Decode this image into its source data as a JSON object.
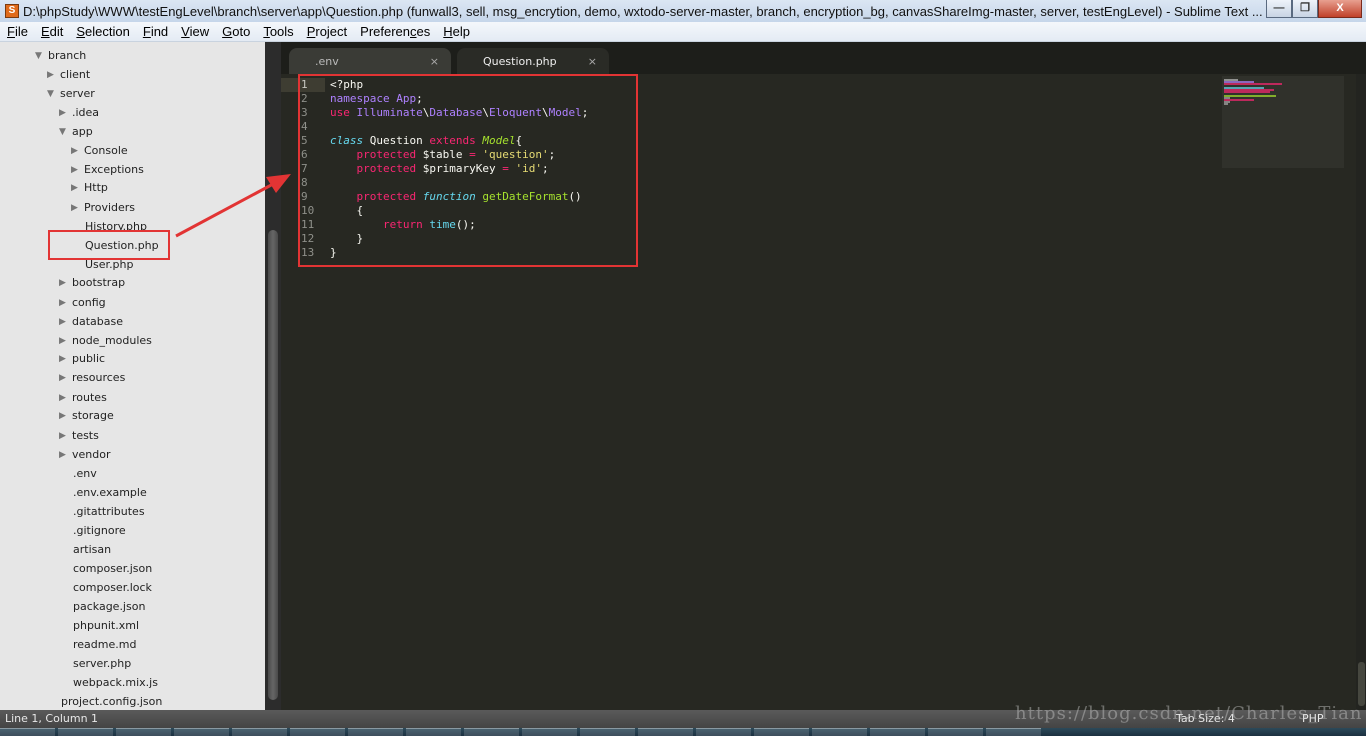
{
  "window": {
    "app_icon_label": "S",
    "title": "D:\\phpStudy\\WWW\\testEngLevel\\branch\\server\\app\\Question.php (funwall3, sell, msg_encrytion, demo, wxtodo-server-master, branch, encryption_bg, canvasShareImg-master, server, testEngLevel) - Sublime Text ...",
    "minimize_glyph": "—",
    "maximize_glyph": "❐",
    "close_glyph": "X"
  },
  "menu": [
    {
      "label": "File"
    },
    {
      "label": "Edit"
    },
    {
      "label": "Selection"
    },
    {
      "label": "Find"
    },
    {
      "label": "View"
    },
    {
      "label": "Goto"
    },
    {
      "label": "Tools"
    },
    {
      "label": "Project"
    },
    {
      "label": "Preferences"
    },
    {
      "label": "Help"
    }
  ],
  "sidebar": {
    "items": [
      {
        "label": "branch",
        "type": "folder-open"
      },
      {
        "label": "client",
        "type": "folder-closed"
      },
      {
        "label": "server",
        "type": "folder-open"
      },
      {
        "label": ".idea",
        "type": "folder-closed"
      },
      {
        "label": "app",
        "type": "folder-open"
      },
      {
        "label": "Console",
        "type": "folder-closed"
      },
      {
        "label": "Exceptions",
        "type": "folder-closed"
      },
      {
        "label": "Http",
        "type": "folder-closed"
      },
      {
        "label": "Providers",
        "type": "folder-closed"
      },
      {
        "label": "History.php",
        "type": "file"
      },
      {
        "label": "Question.php",
        "type": "file",
        "highlighted": true
      },
      {
        "label": "User.php",
        "type": "file"
      },
      {
        "label": "bootstrap",
        "type": "folder-closed"
      },
      {
        "label": "config",
        "type": "folder-closed"
      },
      {
        "label": "database",
        "type": "folder-closed"
      },
      {
        "label": "node_modules",
        "type": "folder-closed"
      },
      {
        "label": "public",
        "type": "folder-closed"
      },
      {
        "label": "resources",
        "type": "folder-closed"
      },
      {
        "label": "routes",
        "type": "folder-closed"
      },
      {
        "label": "storage",
        "type": "folder-closed"
      },
      {
        "label": "tests",
        "type": "folder-closed"
      },
      {
        "label": "vendor",
        "type": "folder-closed"
      },
      {
        "label": ".env",
        "type": "file"
      },
      {
        "label": ".env.example",
        "type": "file"
      },
      {
        "label": ".gitattributes",
        "type": "file"
      },
      {
        "label": ".gitignore",
        "type": "file"
      },
      {
        "label": "artisan",
        "type": "file"
      },
      {
        "label": "composer.json",
        "type": "file"
      },
      {
        "label": "composer.lock",
        "type": "file"
      },
      {
        "label": "package.json",
        "type": "file"
      },
      {
        "label": "phpunit.xml",
        "type": "file"
      },
      {
        "label": "readme.md",
        "type": "file"
      },
      {
        "label": "server.php",
        "type": "file"
      },
      {
        "label": "webpack.mix.js",
        "type": "file"
      },
      {
        "label": "project.config.json",
        "type": "file"
      }
    ]
  },
  "tabs": [
    {
      "label": ".env",
      "active": false,
      "close_glyph": "×"
    },
    {
      "label": "Question.php",
      "active": true,
      "close_glyph": "×"
    }
  ],
  "editor": {
    "current_line": 1,
    "line_numbers": [
      "1",
      "2",
      "3",
      "4",
      "5",
      "6",
      "7",
      "8",
      "9",
      "10",
      "11",
      "12",
      "13"
    ],
    "lines": [
      [
        {
          "t": "<?php",
          "c": "plain"
        }
      ],
      [
        {
          "t": "namespace",
          "c": "ns"
        },
        {
          "t": " ",
          "c": "plain"
        },
        {
          "t": "App",
          "c": "ns"
        },
        {
          "t": ";",
          "c": "plain"
        }
      ],
      [
        {
          "t": "use",
          "c": "kw"
        },
        {
          "t": " ",
          "c": "plain"
        },
        {
          "t": "Illuminate",
          "c": "ns"
        },
        {
          "t": "\\",
          "c": "plain"
        },
        {
          "t": "Database",
          "c": "ns"
        },
        {
          "t": "\\",
          "c": "plain"
        },
        {
          "t": "Eloquent",
          "c": "ns"
        },
        {
          "t": "\\",
          "c": "plain"
        },
        {
          "t": "Model",
          "c": "ns"
        },
        {
          "t": ";",
          "c": "plain"
        }
      ],
      [],
      [
        {
          "t": "class",
          "c": "st"
        },
        {
          "t": " Question ",
          "c": "plain"
        },
        {
          "t": "extends",
          "c": "kw"
        },
        {
          "t": " ",
          "c": "plain"
        },
        {
          "t": "Model",
          "c": "cls-ext"
        },
        {
          "t": "{",
          "c": "plain"
        }
      ],
      [
        {
          "t": "    ",
          "c": "plain"
        },
        {
          "t": "protected",
          "c": "kw"
        },
        {
          "t": " $table ",
          "c": "plain"
        },
        {
          "t": "=",
          "c": "kw"
        },
        {
          "t": " ",
          "c": "plain"
        },
        {
          "t": "'question'",
          "c": "str"
        },
        {
          "t": ";",
          "c": "plain"
        }
      ],
      [
        {
          "t": "    ",
          "c": "plain"
        },
        {
          "t": "protected",
          "c": "kw"
        },
        {
          "t": " $primaryKey ",
          "c": "plain"
        },
        {
          "t": "=",
          "c": "kw"
        },
        {
          "t": " ",
          "c": "plain"
        },
        {
          "t": "'id'",
          "c": "str"
        },
        {
          "t": ";",
          "c": "plain"
        }
      ],
      [],
      [
        {
          "t": "    ",
          "c": "plain"
        },
        {
          "t": "protected",
          "c": "kw"
        },
        {
          "t": " ",
          "c": "plain"
        },
        {
          "t": "function",
          "c": "st"
        },
        {
          "t": " ",
          "c": "plain"
        },
        {
          "t": "getDateFormat",
          "c": "fn"
        },
        {
          "t": "()",
          "c": "plain"
        }
      ],
      [
        {
          "t": "    {",
          "c": "plain"
        }
      ],
      [
        {
          "t": "        ",
          "c": "plain"
        },
        {
          "t": "return",
          "c": "kw"
        },
        {
          "t": " ",
          "c": "plain"
        },
        {
          "t": "time",
          "c": "st-plain"
        },
        {
          "t": "();",
          "c": "plain"
        }
      ],
      [
        {
          "t": "    }",
          "c": "plain"
        }
      ],
      [
        {
          "t": "}",
          "c": "plain"
        }
      ]
    ]
  },
  "statusbar": {
    "position": "Line 1, Column 1",
    "tab_size": "Tab Size: 4",
    "syntax": "PHP"
  },
  "watermark": "https://blog.csdn.net/Charles_Tian",
  "colors": {
    "annotation_red": "#e23434",
    "editor_bg": "#272822",
    "sidebar_bg": "#e6e6e6"
  }
}
